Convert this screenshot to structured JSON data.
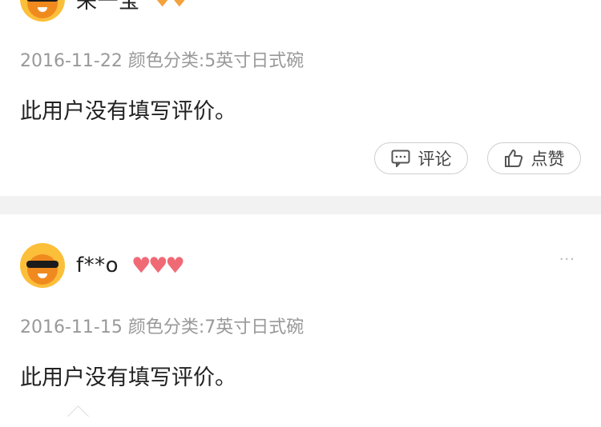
{
  "reviews": [
    {
      "username": "来一宝",
      "meta": "2016-11-22 颜色分类:5英寸日式碗",
      "content": "此用户没有填写评价。",
      "comment_label": "评论",
      "like_label": "点赞"
    },
    {
      "username": "f**o",
      "meta": "2016-11-15 颜色分类:7英寸日式碗",
      "content": "此用户没有填写评价。",
      "more_label": "···"
    }
  ],
  "colors": {
    "avatar_bg": "#fcbf3a",
    "heart": "#f06a76",
    "meta_text": "#999999",
    "divider": "#f2f2f2"
  }
}
